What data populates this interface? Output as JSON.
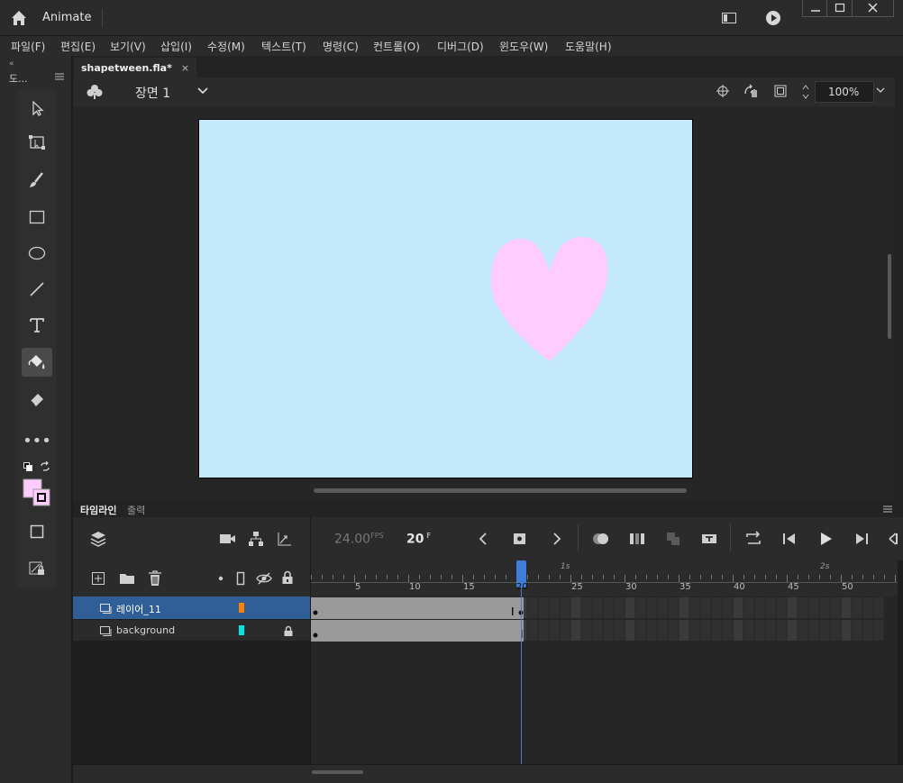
{
  "app": {
    "title": "Animate"
  },
  "menu": [
    "파일(F)",
    "편집(E)",
    "보기(V)",
    "삽입(I)",
    "수정(M)",
    "텍스트(T)",
    "명령(C)",
    "컨트롤(O)",
    "디버그(D)",
    "윈도우(W)",
    "도움말(H)"
  ],
  "tools_panel": {
    "title": "도..."
  },
  "document": {
    "tab_title": "shapetween.fla*",
    "close_glyph": "×"
  },
  "stage_bar": {
    "scene_label": "장면 1",
    "zoom": "100%"
  },
  "stage": {
    "background_color": "#c3e9fb",
    "heart_color": "#ffccff"
  },
  "colors": {
    "stroke": "#000000",
    "fill": "#ffccff"
  },
  "timeline": {
    "tabs": [
      {
        "label": "타임라인",
        "active": true
      },
      {
        "label": "출력",
        "active": false
      }
    ],
    "fps_value": "24.00",
    "fps_unit": "FPS",
    "current_frame": "20",
    "frame_unit": "F",
    "ruler_numbers": [
      "5",
      "10",
      "15",
      "20",
      "25",
      "30",
      "35",
      "40",
      "45",
      "50"
    ],
    "second_marks": [
      "1s",
      "2s"
    ],
    "playhead_frame": 20,
    "layers": [
      {
        "name": "레이어_11",
        "color": "#ff7f00",
        "selected": true,
        "locked": false,
        "span_end_frame": 20
      },
      {
        "name": "background",
        "color": "#00e5e5",
        "selected": false,
        "locked": true,
        "span_end_frame": 20
      }
    ]
  }
}
